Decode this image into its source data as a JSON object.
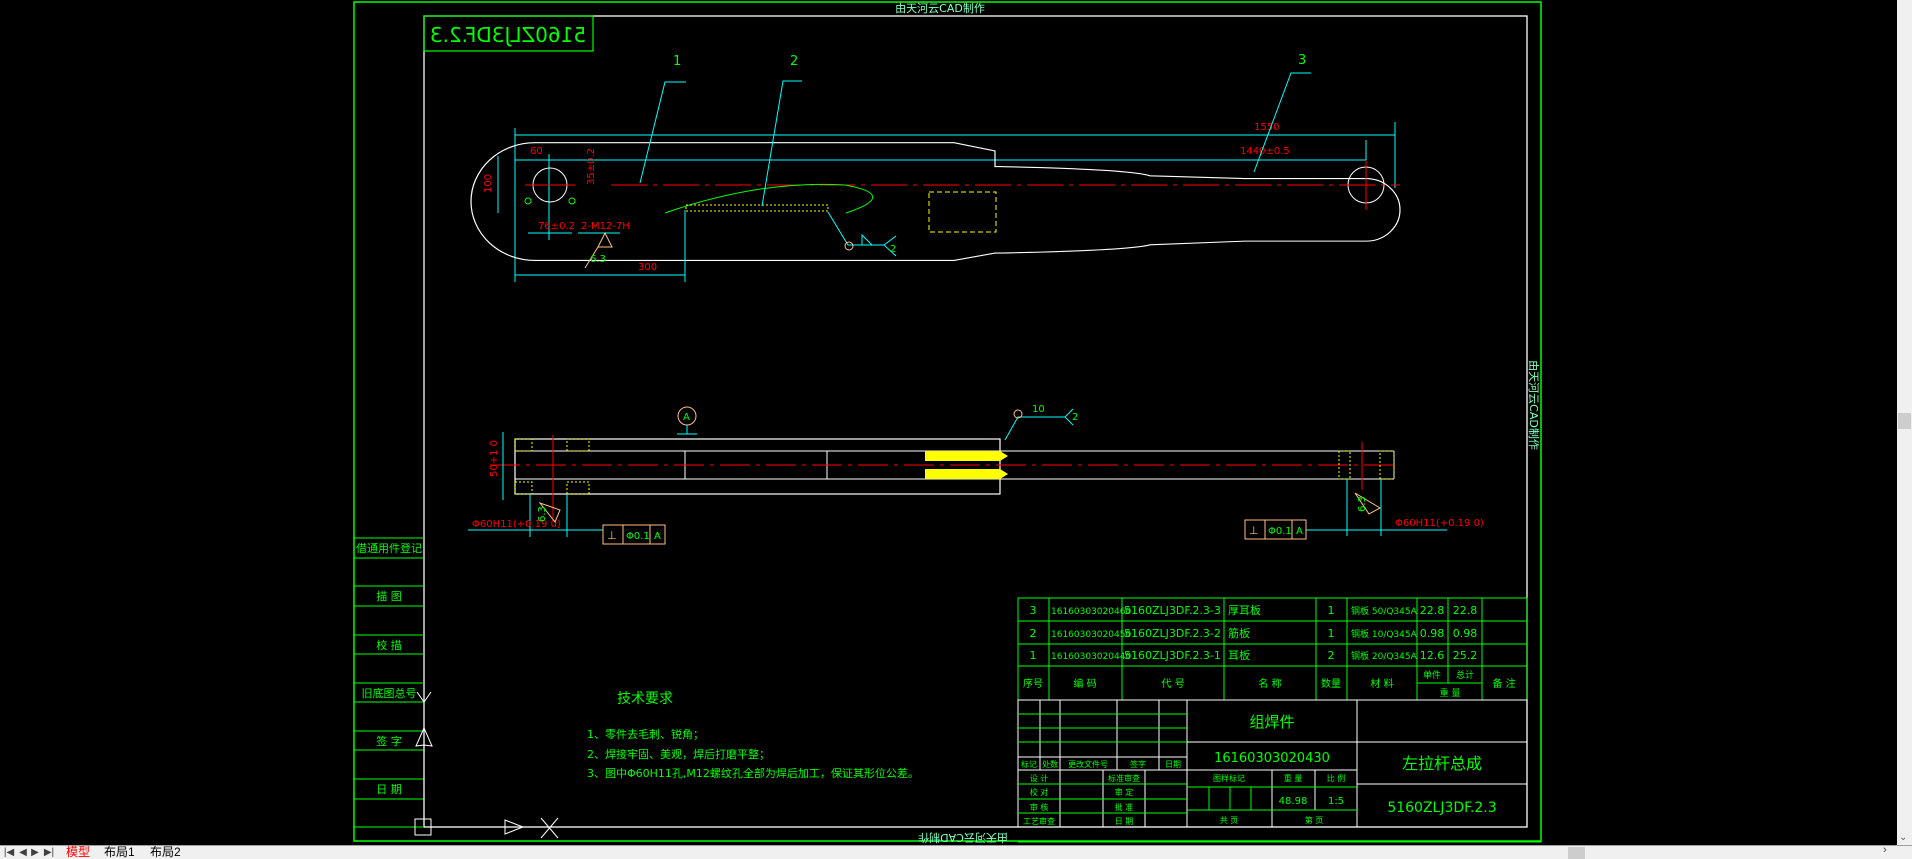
{
  "watermark": "由天河云CAD制作",
  "mirrored_drawing_no": "5160ZLJ3DF.2.3",
  "balloons": [
    "1",
    "2",
    "3"
  ],
  "dimensions": {
    "overall": "1550",
    "centers": "1440±0.5",
    "d60": "60",
    "height": "100",
    "offset35": "35±0.2",
    "d76": "76±0.2",
    "thread": "2-M12-7H",
    "rough1": "6.3",
    "d300": "300",
    "weld_size": "2",
    "lower_width": "50+1 0",
    "datum": "A",
    "weld_top_len": "10",
    "weld_top_size": "2",
    "hole_left": "Φ60H11(+0.19 0)",
    "hole_right": "Φ60H11(+0.19 0)",
    "rough_left": "6.3",
    "rough_right": "6.3",
    "tol_symbol": "⊥",
    "tol_value": "Φ0.1",
    "tol_datum": "A"
  },
  "stamp_column": [
    "借通用件登记",
    "描 图",
    "校 描",
    "旧底图总号",
    "签 字",
    "日 期"
  ],
  "tech_requirements": {
    "title": "技术要求",
    "items": [
      "1、零件去毛刺、锐角；",
      "2、焊接牢固、美观，焊后打磨平整；",
      "3、图中Φ60H11孔,M12螺纹孔全部为焊后加工，保证其形位公差。"
    ]
  },
  "parts_table": {
    "rows": [
      [
        "3",
        "16160303020460",
        "5160ZLJ3DF.2.3-3",
        "厚耳板",
        "1",
        "钢板 50/Q345A",
        "22.8",
        "22.8",
        ""
      ],
      [
        "2",
        "16160303020450",
        "5160ZLJ3DF.2.3-2",
        "筋板",
        "1",
        "钢板 10/Q345A",
        "0.98",
        "0.98",
        ""
      ],
      [
        "1",
        "16160303020440",
        "5160ZLJ3DF.2.3-1",
        "耳板",
        "2",
        "钢板 20/Q345A",
        "12.6",
        "25.2",
        ""
      ]
    ],
    "headers": [
      "序号",
      "编    码",
      "代    号",
      "名    称",
      "数量",
      "材    料",
      "单件",
      "总计",
      "重    量",
      "备  注"
    ]
  },
  "title_block": {
    "rev_labels": [
      "标记",
      "处数",
      "更改文件号",
      "签字",
      "日期"
    ],
    "sign_left": [
      "设 计",
      "校 对",
      "审 核",
      "工艺审查"
    ],
    "sign_right": [
      "标准审查",
      "审 定",
      "批 准",
      "日 期"
    ],
    "part_type": "组焊件",
    "code": "16160303020430",
    "mark_label": "图样标记",
    "weight_label": "重 量",
    "scale_label": "比 例",
    "weight": "48.98",
    "scale": "1:5",
    "sheets_total": "共    页",
    "sheet_no": "第    页",
    "name": "左拉杆总成",
    "drawing_no": "5160ZLJ3DF.2.3"
  },
  "layout_tabs": [
    {
      "label": "模型",
      "active": true
    },
    {
      "label": "布局1",
      "active": false
    },
    {
      "label": "布局2",
      "active": false
    }
  ],
  "colors": {
    "frame": "#00ff00",
    "dimension": "#00ffff",
    "dim_text": "#ff0000",
    "outline": "#ffffff",
    "weld": "#ffff00",
    "symbol": "#ffc080"
  }
}
